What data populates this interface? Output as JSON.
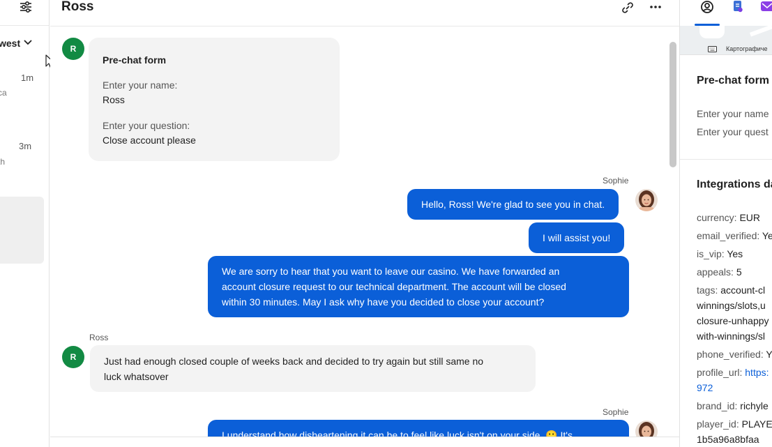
{
  "left_panel": {
    "sort_label": "west",
    "conversations": [
      {
        "time": "1m",
        "snippet": "ca"
      },
      {
        "time": "3m",
        "snippet": "th"
      }
    ]
  },
  "chat": {
    "title": "Ross",
    "customer_initial": "R",
    "prechat": {
      "title": "Pre-chat form",
      "name_label": "Enter your name:",
      "name_value": "Ross",
      "question_label": "Enter your question:",
      "question_value": "Close account please"
    },
    "messages": [
      {
        "sender": "Sophie",
        "text": "Hello, Ross! We're glad to see you in chat."
      },
      {
        "text": "I will assist you!"
      },
      {
        "text_lines": [
          "We are sorry to hear that you want to leave our casino. We have forwarded an",
          "account closure request to our technical department. The account will be closed",
          "within 30 minutes. May I ask why have you decided to close your account?"
        ]
      },
      {
        "sender": "Ross",
        "text_lines": [
          "Just had enough closed couple of weeks back and decided to try again but still same no",
          "luck whatsover"
        ]
      },
      {
        "sender": "Sophie",
        "text": "I understand how disheartening it can be to feel like luck isn't on your side. 🙁 It's"
      }
    ]
  },
  "details": {
    "map_attribution": "Картографиче",
    "prechat_title": "Pre-chat form",
    "prechat_lines": [
      "Enter your name",
      "Enter your quest"
    ],
    "integrations_title": "Integrations da",
    "fields": [
      {
        "key": "currency:",
        "value": "EUR"
      },
      {
        "key": "email_verified:",
        "value": "Ye"
      },
      {
        "key": "is_vip:",
        "value": "Yes"
      },
      {
        "key": "appeals:",
        "value": "5"
      },
      {
        "key": "tags:",
        "value": "account-cl",
        "extra": [
          "winnings/slots,u",
          "closure-unhappy",
          "with-winnings/sl"
        ]
      },
      {
        "key": "phone_verified:",
        "value": "Y"
      },
      {
        "key": "profile_url:",
        "value": "https:",
        "extra": [
          "972"
        ]
      },
      {
        "key": "brand_id:",
        "value": "richyle"
      },
      {
        "key": "player_id:",
        "value": "PLAYE",
        "extra": [
          "1b5a96a8bfaa"
        ]
      }
    ]
  }
}
